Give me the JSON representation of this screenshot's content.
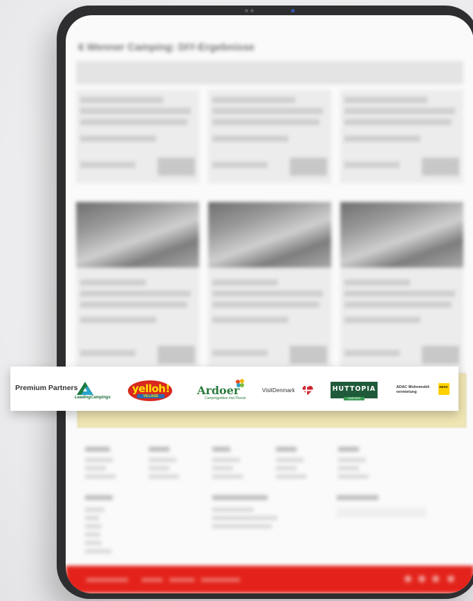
{
  "site": {
    "page_title": "6 Wenner Camping: DIY-Ergebnisse"
  },
  "partners": {
    "label": "Premium Partners",
    "logos": [
      {
        "name": "Leading Campings",
        "text": "LeadingCampings"
      },
      {
        "name": "Yelloh! Village",
        "text": "yelloh!",
        "sub": "VILLAGE"
      },
      {
        "name": "Ardoer",
        "text": "Ardoer",
        "sub": "Campingplätze met Passie"
      },
      {
        "name": "VisitDenmark",
        "text": "VisitDenmark"
      },
      {
        "name": "Huttopia",
        "text": "HUTTOPIA",
        "sub": "CAMPINGS"
      },
      {
        "name": "ADAC Wohnmobil-vermietung",
        "text": "ADAC Wohnmobil-vermietung",
        "badge": "ADAC"
      }
    ]
  },
  "colors": {
    "footer_red": "#e3231b",
    "tablet_frame": "#2e2e30",
    "yelloh_red": "#d8291e",
    "ardoer_green": "#2a7a3d",
    "huttopia_green": "#1f5a3a",
    "adac_yellow": "#ffd200"
  }
}
